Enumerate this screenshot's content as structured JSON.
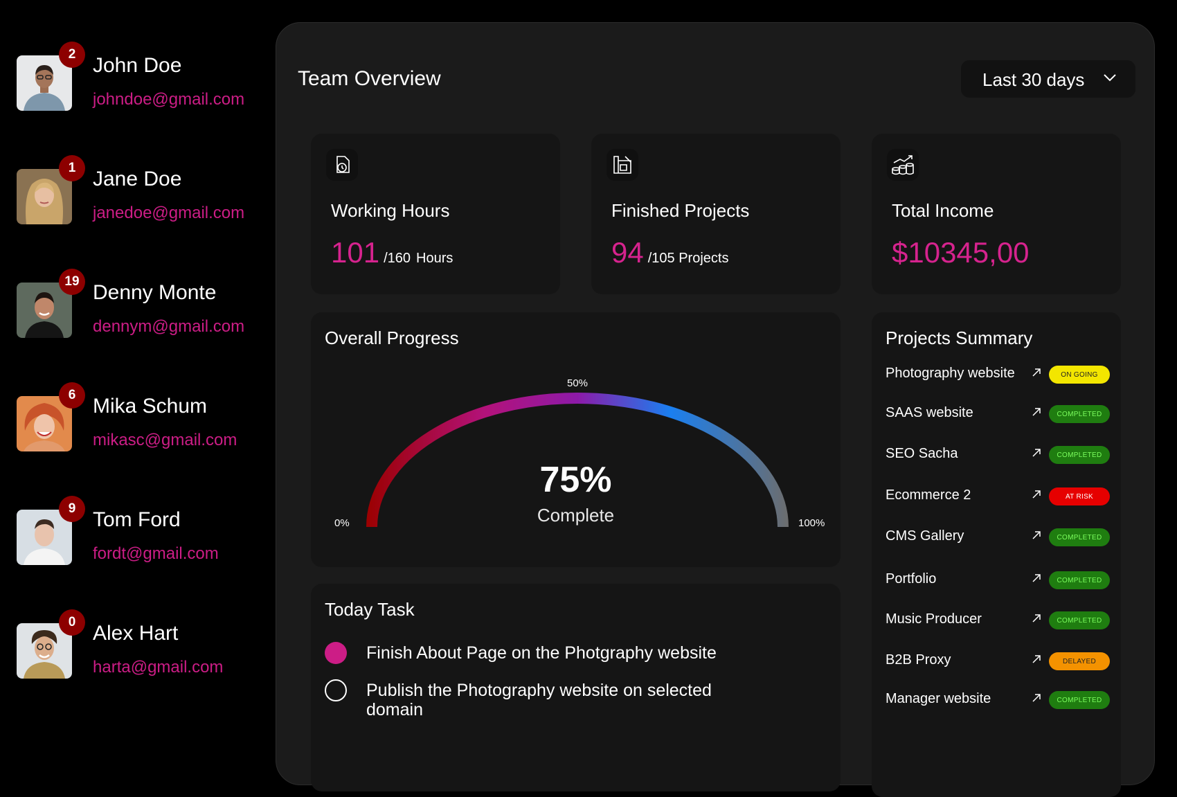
{
  "members": [
    {
      "name": "John Doe",
      "email": "johndoe@gmail.com",
      "count": "2"
    },
    {
      "name": "Jane Doe",
      "email": "janedoe@gmail.com",
      "count": "1"
    },
    {
      "name": "Denny Monte",
      "email": "dennym@gmail.com",
      "count": "19"
    },
    {
      "name": "Mika Schum",
      "email": "mikasc@gmail.com",
      "count": "6"
    },
    {
      "name": "Tom Ford",
      "email": "fordt@gmail.com",
      "count": "9"
    },
    {
      "name": "Alex Hart",
      "email": "harta@gmail.com",
      "count": "0"
    }
  ],
  "header": {
    "title": "Team Overview",
    "range": "Last 30 days"
  },
  "stats": {
    "hours": {
      "title": "Working Hours",
      "value": "101",
      "of": "/160",
      "unit": "Hours",
      "icon": "clock-document-icon"
    },
    "projects": {
      "title": "Finished Projects",
      "value": "94",
      "of": "/105 Projects",
      "icon": "blueprint-icon"
    },
    "income": {
      "title": "Total Income",
      "value": "$10345,00",
      "icon": "coins-growth-icon"
    }
  },
  "progress": {
    "title": "Overall Progress",
    "percent": "75%",
    "percent_value": 75,
    "label": "Complete",
    "min": "0%",
    "mid": "50%",
    "max": "100%"
  },
  "tasks": {
    "title": "Today Task",
    "items": [
      {
        "text": "Finish About Page on the Photgraphy website",
        "done": true
      },
      {
        "text": "Publish the Photography website on selected domain",
        "done": false
      }
    ]
  },
  "summary": {
    "title": "Projects Summary",
    "items": [
      {
        "name": "Photography website",
        "status": "ON GOING"
      },
      {
        "name": "SAAS website",
        "status": "COMPLETED"
      },
      {
        "name": "SEO Sacha",
        "status": "COMPLETED"
      },
      {
        "name": "Ecommerce 2",
        "status": "AT RISK"
      },
      {
        "name": "CMS Gallery",
        "status": "COMPLETED"
      },
      {
        "name": "Portfolio",
        "status": "COMPLETED"
      },
      {
        "name": "Music Producer",
        "status": "COMPLETED"
      },
      {
        "name": "B2B Proxy",
        "status": "DELAYED"
      },
      {
        "name": "Manager website",
        "status": "COMPLETED"
      }
    ]
  },
  "colors": {
    "accent": "#cc1d86",
    "badge": "#8d0000",
    "status_ongoing": "#f3e600",
    "status_completed": "#1f7d10",
    "status_at_risk": "#e60000",
    "status_delayed": "#f49200"
  }
}
